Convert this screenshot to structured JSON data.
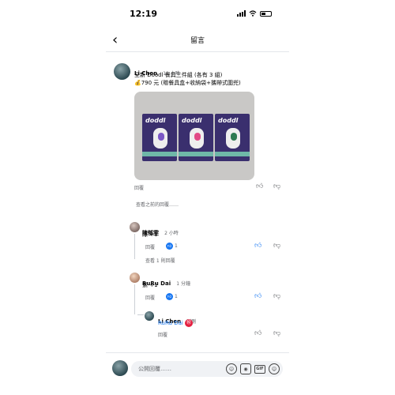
{
  "status": {
    "time": "12:19"
  },
  "nav": {
    "title": "留言"
  },
  "post": {
    "author": "Li Chen",
    "time": "11 小時",
    "line1": "全新 Doodl 餐具三件組 (各有 3 組)",
    "line2": "💰790 元 (贈餐具盒+收納袋+攜帶式圍兜)",
    "reply": "回覆",
    "photo_brand": "doddl",
    "colors": {
      "box": "#3a2f6e",
      "stripe": "#6fb7a8",
      "accent_purple": "#7b57c5",
      "accent_pink": "#e24a86",
      "accent_green": "#2e7a52"
    }
  },
  "previous_replies": "查看之前的回覆……",
  "comments": [
    {
      "author": "陳郁雯",
      "time": "2 小時",
      "text": "綠 +1",
      "reply": "回覆",
      "likes": "1",
      "view_replies": "查看 1 則回覆"
    },
    {
      "author": "RuRu Dai",
      "time": "1 分鐘",
      "text": "紫 +1",
      "reply": "回覆",
      "likes": "1"
    }
  ],
  "nested_reply": {
    "author": "Li Chen",
    "time": "剛剛",
    "mention": "RuRu Dai",
    "sticker": "㊗",
    "reply": "回覆"
  },
  "composer": {
    "placeholder": "公開回覆……",
    "gif_label": "GIF"
  }
}
